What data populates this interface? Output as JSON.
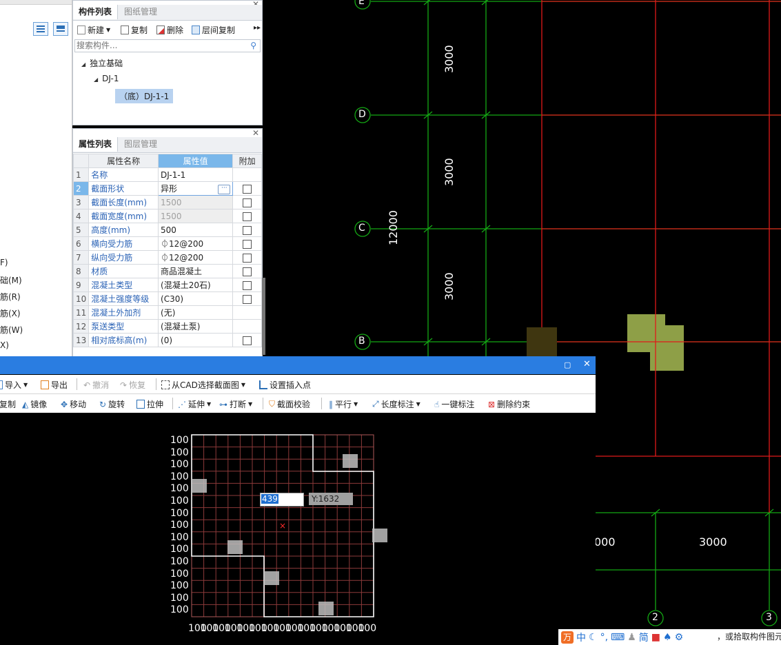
{
  "left_strip": {
    "items": [
      "F)",
      "础(M)",
      "筋(R)",
      "筋(X)",
      "筋(W)",
      "X)"
    ]
  },
  "component_panel": {
    "tabs": [
      "构件列表",
      "图纸管理"
    ],
    "toolbar": {
      "new": "新建",
      "copy": "复制",
      "delete": "删除",
      "floor_copy": "层间复制"
    },
    "search_placeholder": "搜索构件...",
    "tree": {
      "root": "独立基础",
      "child": "DJ-1",
      "leaf": "（底）DJ-1-1"
    }
  },
  "property_panel": {
    "tabs": [
      "属性列表",
      "图层管理"
    ],
    "headers": {
      "name": "属性名称",
      "value": "属性值",
      "extra": "附加"
    },
    "rows": [
      {
        "n": "1",
        "name": "名称",
        "value": "DJ-1-1",
        "check": false
      },
      {
        "n": "2",
        "name": "截面形状",
        "value": "异形",
        "check": true
      },
      {
        "n": "3",
        "name": "截面长度(mm)",
        "value": "1500",
        "check": true
      },
      {
        "n": "4",
        "name": "截面宽度(mm)",
        "value": "1500",
        "check": true
      },
      {
        "n": "5",
        "name": "高度(mm)",
        "value": "500",
        "check": true
      },
      {
        "n": "6",
        "name": "横向受力筋",
        "value": "⏀12@200",
        "check": true
      },
      {
        "n": "7",
        "name": "纵向受力筋",
        "value": "⏀12@200",
        "check": true
      },
      {
        "n": "8",
        "name": "材质",
        "value": "商品混凝土",
        "check": true
      },
      {
        "n": "9",
        "name": "混凝土类型",
        "value": "(混凝土20石)",
        "check": true
      },
      {
        "n": "10",
        "name": "混凝土强度等级",
        "value": "(C30)",
        "check": true
      },
      {
        "n": "11",
        "name": "混凝土外加剂",
        "value": "(无)",
        "check": false
      },
      {
        "n": "12",
        "name": "泵送类型",
        "value": "(混凝土泵)",
        "check": false
      },
      {
        "n": "13",
        "name": "相对底标高(m)",
        "value": "(0)",
        "check": true
      }
    ]
  },
  "cad": {
    "axis_labels": [
      "E",
      "D",
      "C",
      "B",
      "2",
      "3"
    ],
    "dims": {
      "v1": "3000",
      "v2": "3000",
      "v3": "3000",
      "total": "12000",
      "h_left": "000",
      "h_right": "3000"
    },
    "colors": {
      "grid": "#14a814",
      "red": "#e01a1a",
      "fill": "#8e9f47",
      "fill_dark": "#3f3610"
    }
  },
  "dialog": {
    "toolbar1": {
      "import": "导入",
      "export": "导出",
      "undo": "撤消",
      "redo": "恢复",
      "from_cad": "从CAD选择截面图",
      "insert_point": "设置插入点"
    },
    "toolbar2": {
      "copy": "复制",
      "mirror": "镜像",
      "move": "移动",
      "rotate": "旋转",
      "stretch": "拉伸",
      "extend": "延伸",
      "break": "打断",
      "check": "截面校验",
      "parallel": "平行",
      "length_dim": "长度标注",
      "auto_dim": "一键标注",
      "del_constraint": "删除约束"
    },
    "row_labels": [
      "100",
      "100",
      "100",
      "100",
      "100",
      "100",
      "100",
      "100",
      "100",
      "100",
      "100",
      "100",
      "100",
      "100",
      "100"
    ],
    "col_labels": [
      "100",
      "100",
      "100",
      "100",
      "100",
      "100",
      "100",
      "100",
      "100",
      "100",
      "100",
      "100",
      "100",
      "100",
      "100"
    ],
    "input_x": "439",
    "input_y": "Y:1632"
  },
  "ime": {
    "brand": "万",
    "mode": "中",
    "simp": "简"
  },
  "status_tail": "，或拾取构件图元"
}
